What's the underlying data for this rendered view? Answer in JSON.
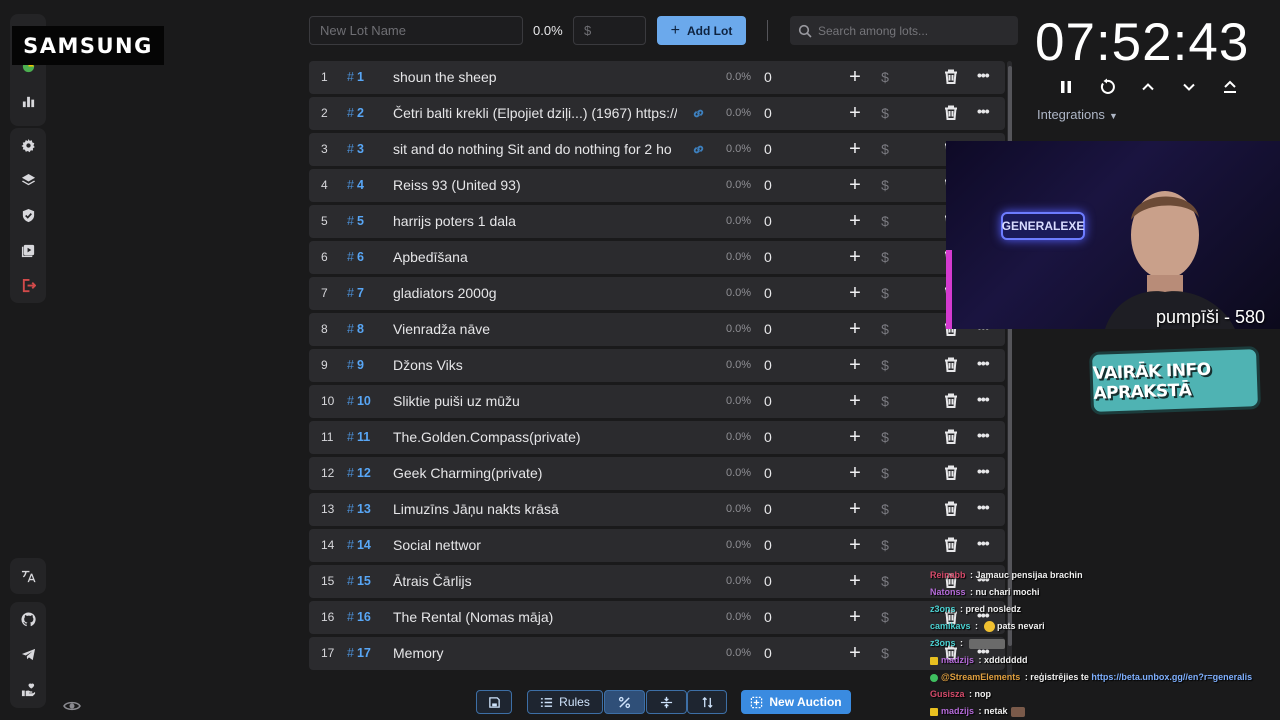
{
  "overlay": {
    "samsung_logo": "SAMSUNG",
    "timer": "07:52:43",
    "webcam_caption": "pumpīši - 580",
    "webcam_sign": "GENERALEXE",
    "info_badge": "VAIRĀK INFO APRAKSTĀ"
  },
  "toolbar": {
    "lot_name_placeholder": "New Lot Name",
    "percent": "0.0%",
    "amount_placeholder": "$",
    "add_lot_label": "Add Lot",
    "search_placeholder": "Search among lots..."
  },
  "integrations_label": "Integrations",
  "lots": [
    {
      "index": "1",
      "id": "1",
      "name": "shoun the sheep",
      "has_link": false,
      "percent": "0.0%",
      "amount": "0"
    },
    {
      "index": "2",
      "id": "2",
      "name": "Četri balti krekli (Elpojiet dziļi...) (1967) https://",
      "has_link": true,
      "percent": "0.0%",
      "amount": "0"
    },
    {
      "index": "3",
      "id": "3",
      "name": "sit and do nothing Sit and do nothing for 2 ho",
      "has_link": true,
      "percent": "0.0%",
      "amount": "0"
    },
    {
      "index": "4",
      "id": "4",
      "name": "Reiss 93 (United 93)",
      "has_link": false,
      "percent": "0.0%",
      "amount": "0"
    },
    {
      "index": "5",
      "id": "5",
      "name": "harrijs poters 1 dala",
      "has_link": false,
      "percent": "0.0%",
      "amount": "0"
    },
    {
      "index": "6",
      "id": "6",
      "name": "Apbedīšana",
      "has_link": false,
      "percent": "0.0%",
      "amount": "0"
    },
    {
      "index": "7",
      "id": "7",
      "name": "gladiators 2000g",
      "has_link": false,
      "percent": "0.0%",
      "amount": "0"
    },
    {
      "index": "8",
      "id": "8",
      "name": "Vienradža nāve",
      "has_link": false,
      "percent": "0.0%",
      "amount": "0"
    },
    {
      "index": "9",
      "id": "9",
      "name": "Džons Viks",
      "has_link": false,
      "percent": "0.0%",
      "amount": "0"
    },
    {
      "index": "10",
      "id": "10",
      "name": "Sliktie puiši uz mūžu",
      "has_link": false,
      "percent": "0.0%",
      "amount": "0"
    },
    {
      "index": "11",
      "id": "11",
      "name": "The.Golden.Compass(private)",
      "has_link": false,
      "percent": "0.0%",
      "amount": "0"
    },
    {
      "index": "12",
      "id": "12",
      "name": "Geek Charming(private)",
      "has_link": false,
      "percent": "0.0%",
      "amount": "0"
    },
    {
      "index": "13",
      "id": "13",
      "name": "Limuzīns Jāņu nakts krāsā",
      "has_link": false,
      "percent": "0.0%",
      "amount": "0"
    },
    {
      "index": "14",
      "id": "14",
      "name": "Social nettwor",
      "has_link": false,
      "percent": "0.0%",
      "amount": "0"
    },
    {
      "index": "15",
      "id": "15",
      "name": "Ātrais Čārlijs",
      "has_link": false,
      "percent": "0.0%",
      "amount": "0"
    },
    {
      "index": "16",
      "id": "16",
      "name": "The Rental (Nomas māja)",
      "has_link": false,
      "percent": "0.0%",
      "amount": "0"
    },
    {
      "index": "17",
      "id": "17",
      "name": "Memory",
      "has_link": false,
      "percent": "0.0%",
      "amount": "0"
    }
  ],
  "lot_actions": {
    "plus": "+",
    "dollar": "$",
    "more": "•••",
    "hash": "#"
  },
  "bottom_bar": {
    "rules_label": "Rules",
    "new_auction_label": "New Auction"
  },
  "chat": [
    {
      "user": "Reinabb",
      "user_color": "#d44a6a",
      "text": " : Jamauc pensijaa brachin"
    },
    {
      "user": "Natonss",
      "user_color": "#b46ad8",
      "text": " : nu chari mochi"
    },
    {
      "user": "z3ons",
      "user_color": "#4ad0d0",
      "text": " : pred nosledz"
    },
    {
      "user": "camikavs",
      "user_color": "#4ad0d0",
      "text": " : ",
      "emote": "face",
      "text2": " pats nevari"
    },
    {
      "user": "z3ons",
      "user_color": "#4ad0d0",
      "text": " : ",
      "emote": "wide"
    },
    {
      "user": "madzijs",
      "user_color": "#b46ad8",
      "badge": "yellow",
      "text": " : xddddddd"
    },
    {
      "user": "@StreamElements",
      "user_color": "#e0a040",
      "badge": "green",
      "text": " : reģistrējies te ",
      "link": "https://beta.unbox.gg//en?r=generalis"
    },
    {
      "user": "Gusisza",
      "user_color": "#d44a6a",
      "text": " : nop"
    },
    {
      "user": "madzijs",
      "user_color": "#b46ad8",
      "badge": "yellow",
      "text": " : netak",
      "emote": "small"
    }
  ],
  "colors": {
    "accent": "#6ba9ec",
    "lot_id": "#58a6f5",
    "row_bg": "#2b2b2e",
    "page_bg": "#1a1a1b",
    "logout": "#d24a4a"
  }
}
